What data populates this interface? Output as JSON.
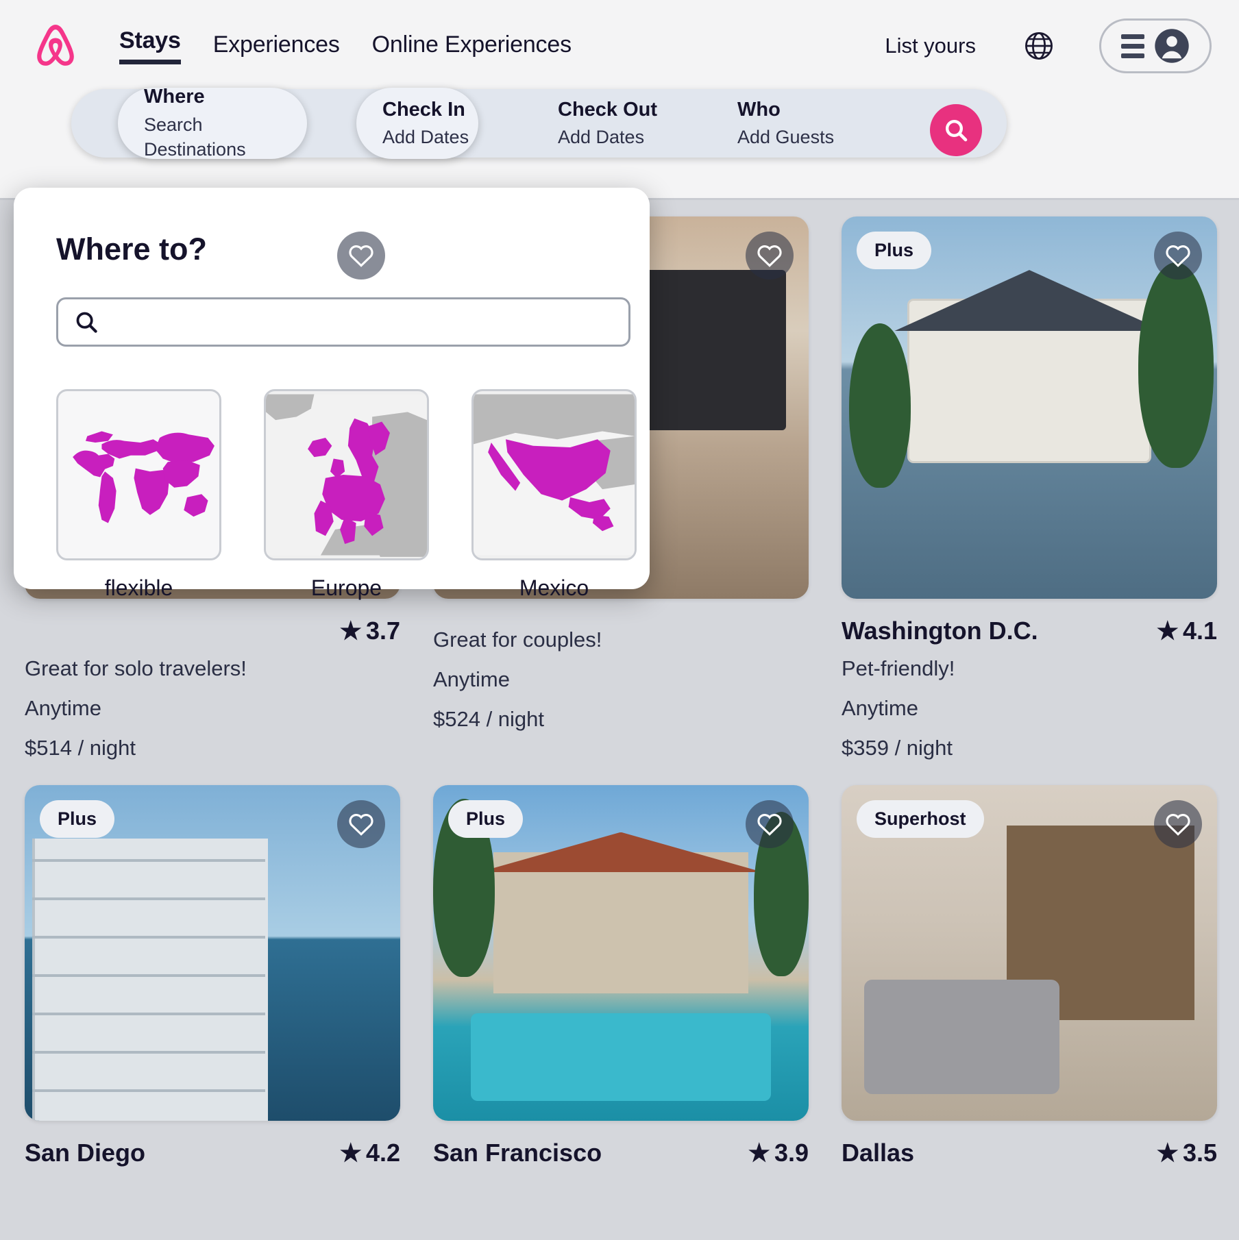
{
  "brand": {
    "accent_pink": "#e8317f",
    "logo_name": "airbnb-logo"
  },
  "navbar": {
    "links": [
      {
        "label": "Stays",
        "active": true
      },
      {
        "label": "Experiences",
        "active": false
      },
      {
        "label": "Online Experiences",
        "active": false
      }
    ],
    "list_yours": "List yours",
    "globe_icon": "globe-icon",
    "menu_icon": "hamburger-icon",
    "avatar_icon": "user-avatar-icon"
  },
  "searchbar": {
    "segments": [
      {
        "title": "Where",
        "sub": "Search Destinations",
        "active": true
      },
      {
        "title": "Check In",
        "sub": "Add Dates",
        "active": true
      },
      {
        "title": "Check Out",
        "sub": "Add Dates",
        "active": false
      },
      {
        "title": "Who",
        "sub": "Add Guests",
        "active": false
      }
    ],
    "search_button_icon": "search-icon"
  },
  "modal": {
    "title": "Where to?",
    "search_value": "",
    "search_placeholder": "",
    "search_icon": "search-icon",
    "regions": [
      {
        "label": "flexible",
        "map": "world"
      },
      {
        "label": "Europe",
        "map": "europe"
      },
      {
        "label": "Mexico",
        "map": "mexico"
      }
    ]
  },
  "listings": {
    "row1": [
      {
        "title": "",
        "rating": "3.7",
        "tag": "Great for solo travelers!",
        "when": "Anytime",
        "price": "$514 / night",
        "badge": "",
        "photo": "interior",
        "heart_icon": "heart-icon"
      },
      {
        "title": "",
        "rating": "",
        "tag": "Great for couples!",
        "when": "Anytime",
        "price": "$524 / night",
        "badge": "",
        "photo": "interior",
        "heart_icon": "heart-icon"
      },
      {
        "title": "Washington D.C.",
        "rating": "4.1",
        "tag": "Pet-friendly!",
        "when": "Anytime",
        "price": "$359 / night",
        "badge": "Plus",
        "photo": "lake",
        "heart_icon": "heart-icon"
      }
    ],
    "row2": [
      {
        "title": "San Diego",
        "rating": "4.2",
        "tag": "",
        "when": "",
        "price": "",
        "badge": "Plus",
        "photo": "tower",
        "heart_icon": "heart-icon"
      },
      {
        "title": "San Francisco",
        "rating": "3.9",
        "tag": "",
        "when": "",
        "price": "",
        "badge": "Plus",
        "photo": "villa",
        "heart_icon": "heart-icon"
      },
      {
        "title": "Dallas",
        "rating": "3.5",
        "tag": "",
        "when": "",
        "price": "",
        "badge": "Superhost",
        "photo": "living",
        "heart_icon": "heart-icon"
      }
    ]
  },
  "star_glyph": "★"
}
